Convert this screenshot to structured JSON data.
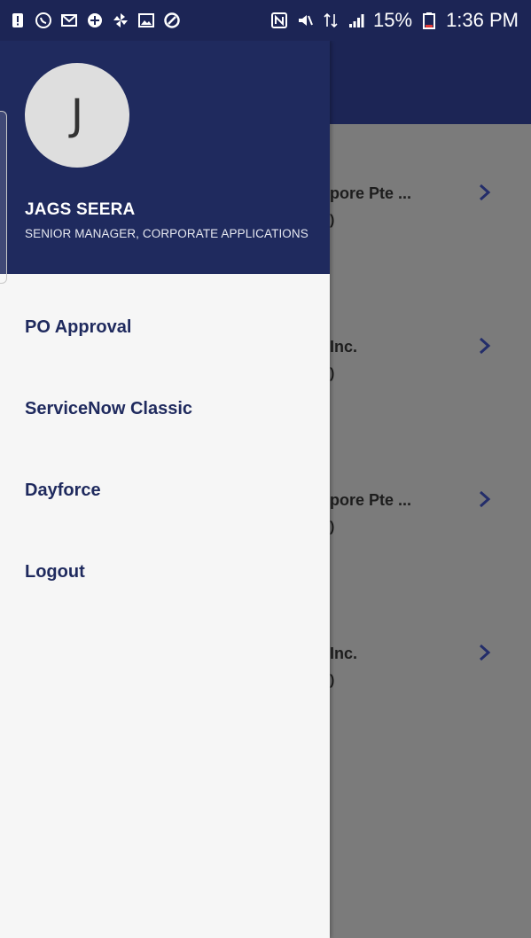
{
  "status_bar": {
    "left_icons": [
      "alert-icon",
      "whatsapp-icon",
      "gmail-icon",
      "plus-circle-icon",
      "pinwheel-icon",
      "image-icon",
      "sync-icon"
    ],
    "right_icons": [
      "nfc-icon",
      "mute-icon",
      "data-icon",
      "signal-icon",
      "battery-icon"
    ],
    "battery_percent": "15%",
    "time": "1:36 PM"
  },
  "drawer": {
    "avatar_initial": "J",
    "user_name": "JAGS SEERA",
    "user_title": "SENIOR MANAGER, CORPORATE APPLICATIONS",
    "menu_items": [
      {
        "label": "PO Approval"
      },
      {
        "label": "ServiceNow Classic"
      },
      {
        "label": "Dayforce"
      },
      {
        "label": "Logout"
      }
    ]
  },
  "background_list": {
    "rows": [
      {
        "title": "pore Pte ...",
        "sub": ")"
      },
      {
        "title": "Inc.",
        "sub": ")"
      },
      {
        "title": "pore Pte ...",
        "sub": ")"
      },
      {
        "title": "Inc.",
        "sub": ")"
      }
    ]
  },
  "colors": {
    "primary": "#1f2a5e",
    "status_bar": "#1c2555",
    "scrim": "#7b7b7b",
    "drawer_bg": "#f6f6f6"
  }
}
